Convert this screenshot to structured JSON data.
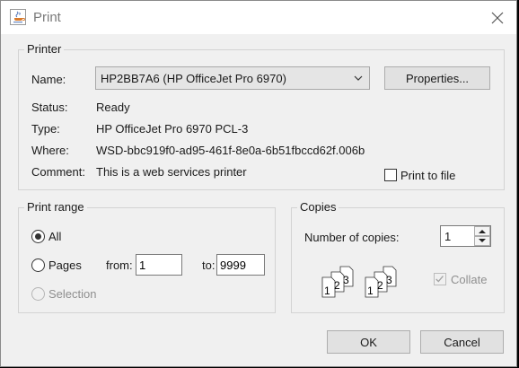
{
  "window": {
    "title": "Print"
  },
  "printer": {
    "group_label": "Printer",
    "name_label": "Name:",
    "name_value": "HP2BB7A6 (HP OfficeJet Pro 6970)",
    "properties_label": "Properties...",
    "status_label": "Status:",
    "status_value": "Ready",
    "type_label": "Type:",
    "type_value": "HP OfficeJet Pro 6970 PCL-3",
    "where_label": "Where:",
    "where_value": "WSD-bbc919f0-ad95-461f-8e0a-6b51fbccd62f.006b",
    "comment_label": "Comment:",
    "comment_value": "This is a web services printer",
    "print_to_file_label": "Print to file",
    "print_to_file_checked": false
  },
  "print_range": {
    "group_label": "Print range",
    "all_label": "All",
    "pages_label": "Pages",
    "from_label": "from:",
    "from_value": "1",
    "to_label": "to:",
    "to_value": "9999",
    "selection_label": "Selection",
    "selected": "all"
  },
  "copies": {
    "group_label": "Copies",
    "number_label": "Number of copies:",
    "number_value": "1",
    "collate_label": "Collate",
    "collate_checked": true,
    "collate_enabled": false,
    "collate_pages": [
      "1",
      "2",
      "3"
    ]
  },
  "buttons": {
    "ok": "OK",
    "cancel": "Cancel"
  },
  "colors": {
    "title_text": "#7a7a7a",
    "panel_bg": "#f0f0f0",
    "button_bg": "#e1e1e1"
  }
}
